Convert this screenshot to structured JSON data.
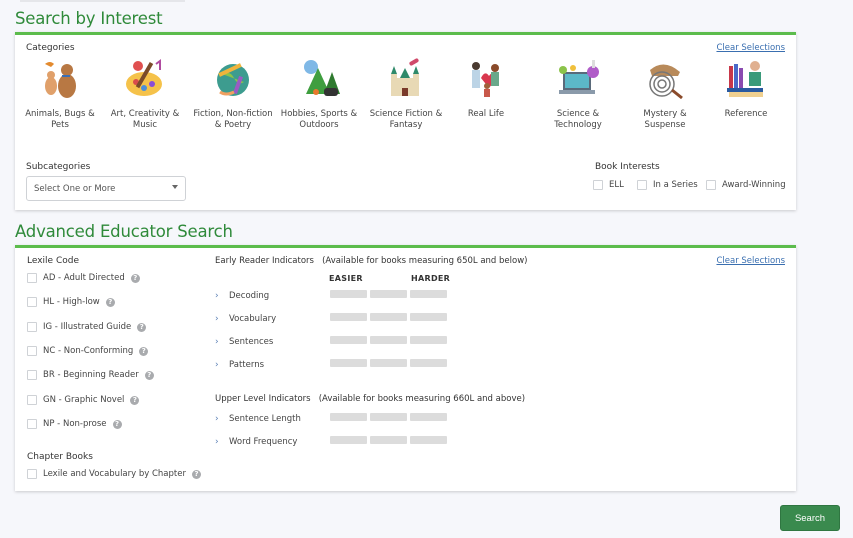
{
  "interest": {
    "title": "Search by Interest",
    "categories_label": "Categories",
    "clear_label": "Clear Selections",
    "categories": [
      {
        "label": "Animals, Bugs & Pets",
        "icon": "animals-icon"
      },
      {
        "label": "Art, Creativity & Music",
        "icon": "art-icon"
      },
      {
        "label": "Fiction, Non-fiction & Poetry",
        "icon": "globe-books-icon"
      },
      {
        "label": "Hobbies, Sports & Outdoors",
        "icon": "hobbies-icon"
      },
      {
        "label": "Science Fiction & Fantasy",
        "icon": "castle-rocket-icon"
      },
      {
        "label": "Real Life",
        "icon": "family-icon"
      },
      {
        "label": "Science & Technology",
        "icon": "laptop-science-icon"
      },
      {
        "label": "Mystery & Suspense",
        "icon": "fingerprint-icon"
      },
      {
        "label": "Reference",
        "icon": "books-reader-icon"
      }
    ],
    "subcategories_label": "Subcategories",
    "subcategories_placeholder": "Select One or More",
    "book_interests_label": "Book Interests",
    "book_interests": [
      "ELL",
      "In a Series",
      "Award-Winning"
    ]
  },
  "advanced": {
    "title": "Advanced Educator Search",
    "clear_label": "Clear Selections",
    "lexile_label": "Lexile Code",
    "lexile_codes": [
      "AD - Adult Directed",
      "HL - High-low",
      "IG - Illustrated Guide",
      "NC - Non-Conforming",
      "BR - Beginning Reader",
      "GN - Graphic Novel",
      "NP - Non-prose"
    ],
    "chapter_label": "Chapter Books",
    "chapter_option": "Lexile and Vocabulary by Chapter",
    "early_label": "Early Reader Indicators",
    "early_note": "(Available for books measuring 650L and below)",
    "easier": "EASIER",
    "harder": "HARDER",
    "early_indicators": [
      "Decoding",
      "Vocabulary",
      "Sentences",
      "Patterns"
    ],
    "upper_label": "Upper Level Indicators",
    "upper_note": "(Available for books measuring 660L and above)",
    "upper_indicators": [
      "Sentence Length",
      "Word Frequency"
    ]
  },
  "search_label": "Search",
  "colors": {
    "accent": "#5cbc4c",
    "title": "#2f8a3a",
    "button": "#3a8a4e",
    "link": "#3a6fb0"
  }
}
